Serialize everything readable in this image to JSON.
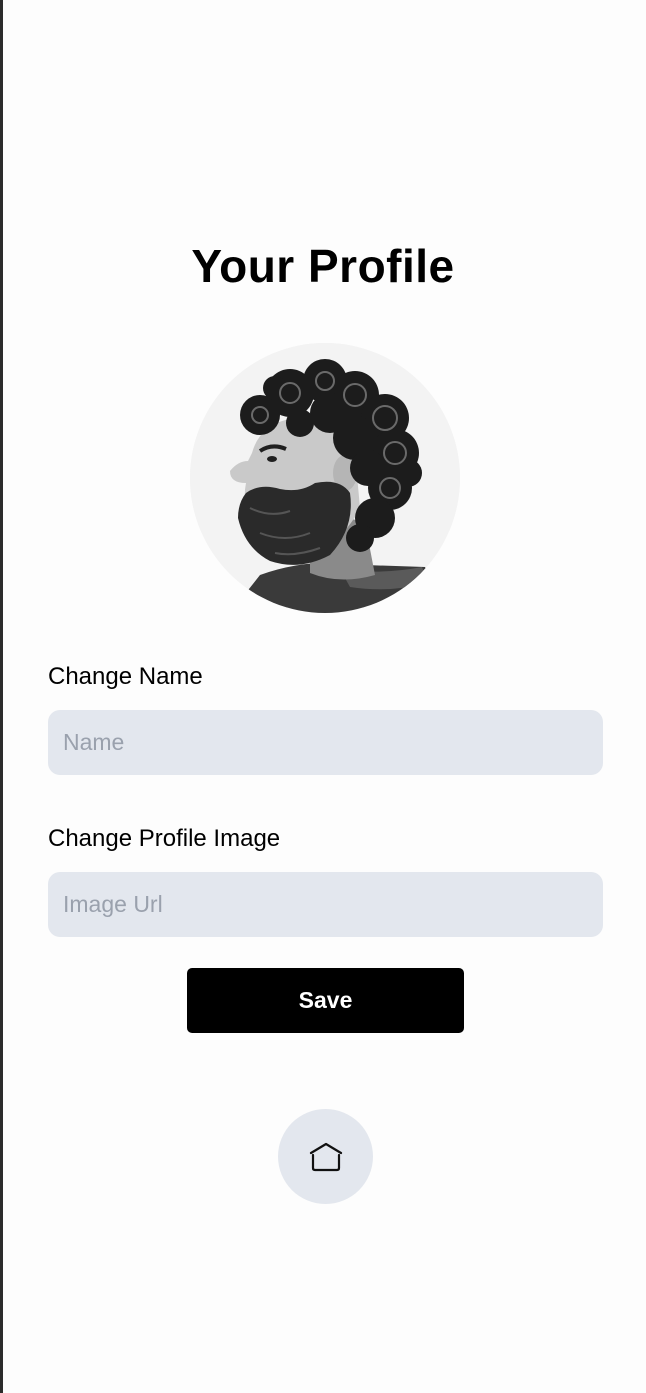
{
  "header": {
    "title": "Your Profile"
  },
  "avatar": {
    "icon": "profile-photo"
  },
  "form": {
    "name_label": "Change Name",
    "name_placeholder": "Name",
    "name_value": "",
    "image_label": "Change Profile Image",
    "image_placeholder": "Image Url",
    "image_value": "",
    "save_label": "Save"
  },
  "nav": {
    "home_icon": "home-icon"
  },
  "colors": {
    "background": "#fdfdfd",
    "input_background": "#e3e7ee",
    "placeholder": "#9aa1ad",
    "button_background": "#000000",
    "button_text": "#ffffff"
  }
}
